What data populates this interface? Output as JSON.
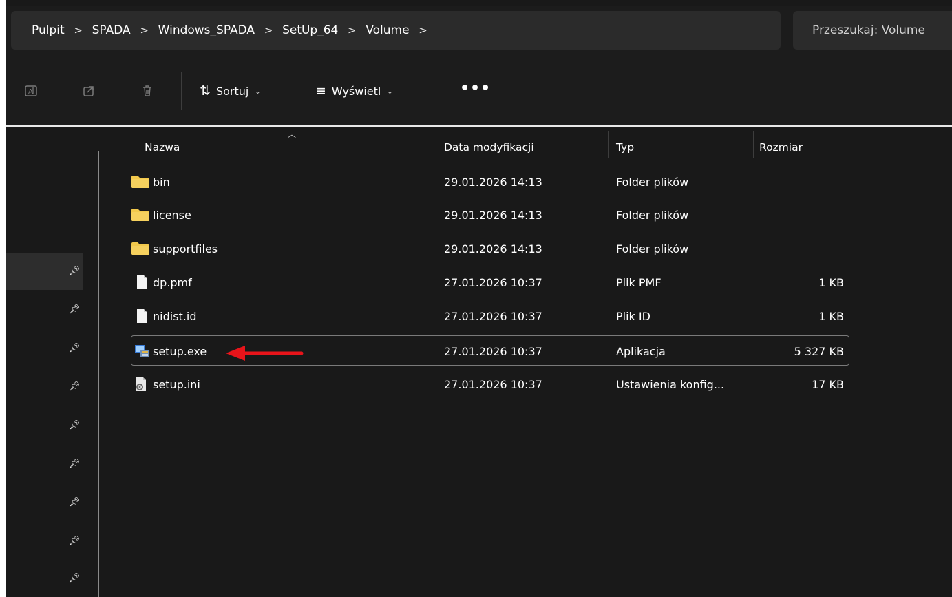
{
  "breadcrumb": [
    "Pulpit",
    "SPADA",
    "Windows_SPADA",
    "SetUp_64",
    "Volume"
  ],
  "search": {
    "placeholder": "Przeszukaj: Volume"
  },
  "commandbar": {
    "sort_label": "Sortuj",
    "view_label": "Wyświetl",
    "icons": [
      "rename-icon",
      "share-icon",
      "delete-icon",
      "sort-icon",
      "view-icon",
      "more-icon"
    ]
  },
  "columns": {
    "name": "Nazwa",
    "date": "Data modyfikacji",
    "type": "Typ",
    "size": "Rozmiar"
  },
  "files": [
    {
      "name": "bin",
      "date": "29.01.2026 14:13",
      "type": "Folder plików",
      "size": "",
      "icon": "folder-icon"
    },
    {
      "name": "license",
      "date": "29.01.2026 14:13",
      "type": "Folder plików",
      "size": "",
      "icon": "folder-icon"
    },
    {
      "name": "supportfiles",
      "date": "29.01.2026 14:13",
      "type": "Folder plików",
      "size": "",
      "icon": "folder-icon"
    },
    {
      "name": "dp.pmf",
      "date": "27.01.2026 10:37",
      "type": "Plik PMF",
      "size": "1 KB",
      "icon": "file-icon"
    },
    {
      "name": "nidist.id",
      "date": "27.01.2026 10:37",
      "type": "Plik ID",
      "size": "1 KB",
      "icon": "file-icon"
    },
    {
      "name": "setup.exe",
      "date": "27.01.2026 10:37",
      "type": "Aplikacja",
      "size": "5 327 KB",
      "icon": "installer-icon"
    },
    {
      "name": "setup.ini",
      "date": "27.01.2026 10:37",
      "type": "Ustawienia konfig...",
      "size": "17 KB",
      "icon": "settings-file-icon"
    }
  ],
  "colors": {
    "background": "#191919",
    "annotation_arrow": "#e8141a",
    "folder": "#f2c94c"
  }
}
